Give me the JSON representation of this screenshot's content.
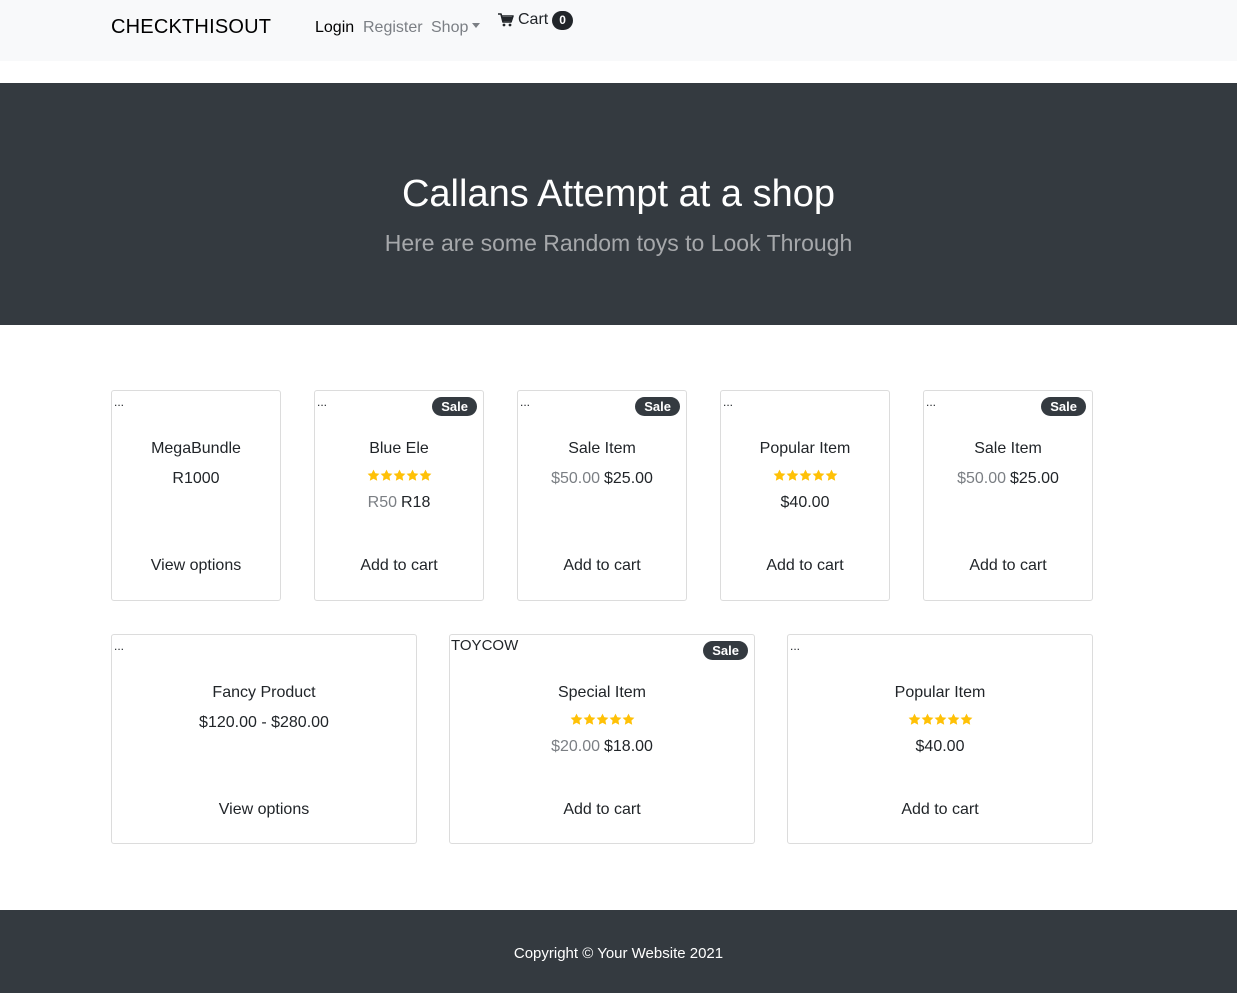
{
  "nav": {
    "brand": "CHECKTHISOUT",
    "login": "Login",
    "register": "Register",
    "shop": "Shop",
    "cart_label": "Cart",
    "cart_count": "0"
  },
  "hero": {
    "title": "Callans Attempt at a shop",
    "subtitle": "Here are some Random toys to Look Through"
  },
  "colors": {
    "dark": "#343a40",
    "star": "#ffc107",
    "muted": "#7b7f84"
  },
  "products": [
    {
      "image_alt": "...",
      "sale": "",
      "name": "MegaBundle",
      "rating": 0,
      "old_price": "",
      "price": "R1000",
      "action": "View options"
    },
    {
      "image_alt": "...",
      "sale": "Sale",
      "name": "Blue Ele",
      "rating": 5,
      "old_price": "R50",
      "price": "R18",
      "action": "Add to cart"
    },
    {
      "image_alt": "...",
      "sale": "Sale",
      "name": "Sale Item",
      "rating": 0,
      "old_price": "$50.00",
      "price": "$25.00",
      "action": "Add to cart"
    },
    {
      "image_alt": "...",
      "sale": "",
      "name": "Popular Item",
      "rating": 5,
      "old_price": "",
      "price": "$40.00",
      "action": "Add to cart"
    },
    {
      "image_alt": "...",
      "sale": "Sale",
      "name": "Sale Item",
      "rating": 0,
      "old_price": "$50.00",
      "price": "$25.00",
      "action": "Add to cart"
    },
    {
      "image_alt": "...",
      "sale": "",
      "name": "Fancy Product",
      "rating": 0,
      "old_price": "",
      "price": "$120.00 - $280.00",
      "action": "View options"
    },
    {
      "image_alt": "TOYCOW",
      "sale": "Sale",
      "name": "Special Item",
      "rating": 5,
      "old_price": "$20.00",
      "price": "$18.00",
      "action": "Add to cart"
    },
    {
      "image_alt": "...",
      "sale": "",
      "name": "Popular Item",
      "rating": 5,
      "old_price": "",
      "price": "$40.00",
      "action": "Add to cart"
    }
  ],
  "footer": {
    "copyright": "Copyright © Your Website 2021"
  }
}
